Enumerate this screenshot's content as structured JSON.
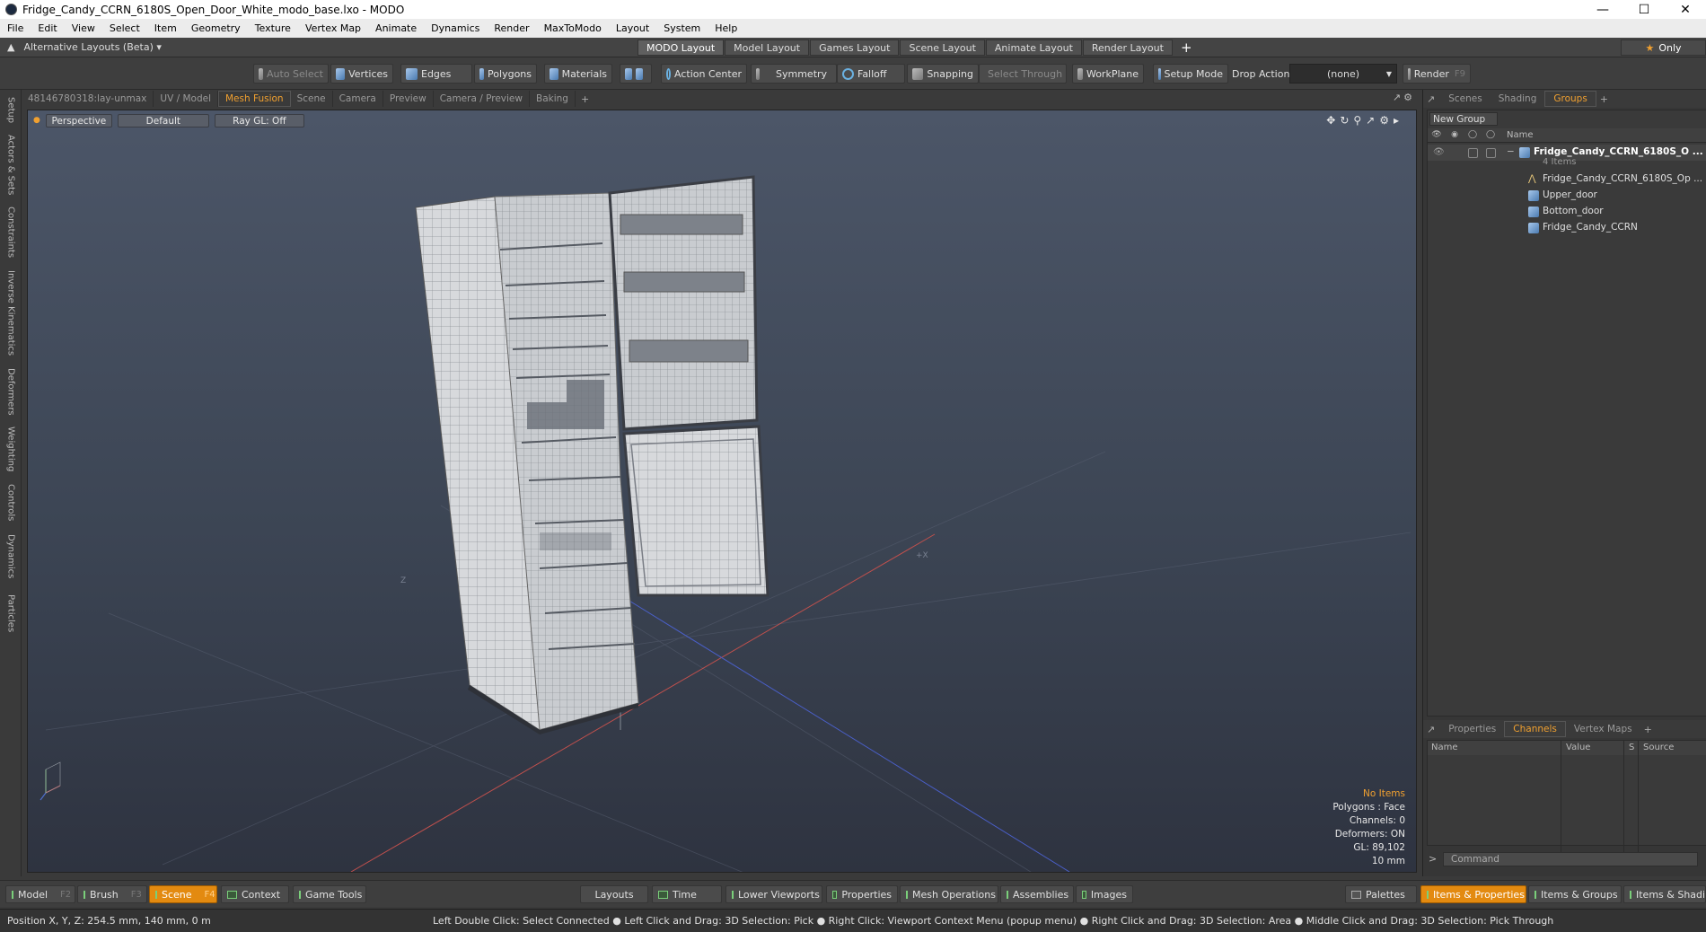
{
  "window": {
    "title": "Fridge_Candy_CCRN_6180S_Open_Door_White_modo_base.lxo - MODO"
  },
  "menu": [
    "File",
    "Edit",
    "View",
    "Select",
    "Item",
    "Geometry",
    "Texture",
    "Vertex Map",
    "Animate",
    "Dynamics",
    "Render",
    "MaxToModo",
    "Layout",
    "System",
    "Help"
  ],
  "layoutbar": {
    "alt_layouts": "Alternative Layouts (Beta) ▾",
    "tabs": [
      "MODO Layout",
      "Model Layout",
      "Games Layout",
      "Scene Layout",
      "Animate Layout",
      "Render Layout"
    ],
    "only": "Only"
  },
  "toolbar": {
    "auto_select": "Auto Select",
    "vertices": "Vertices",
    "edges": "Edges",
    "polygons": "Polygons",
    "materials": "Materials",
    "action_center": "Action Center",
    "symmetry": "Symmetry",
    "falloff": "Falloff",
    "snapping": "Snapping",
    "select_through": "Select Through",
    "workplane": "WorkPlane",
    "setup_mode": "Setup Mode",
    "drop_action": "Drop Action",
    "drop_value": "(none)",
    "render": "Render",
    "render_key": "F9"
  },
  "left_tabs": [
    "Setup",
    "Actors & Sets",
    "Constraints",
    "Inverse Kinematics",
    "Deformers",
    "Weighting",
    "Controls",
    "Dynamics",
    "Particles"
  ],
  "viewport_tabs": [
    "48146780318:lay-unmax",
    "UV / Model",
    "Mesh Fusion",
    "Scene",
    "Camera",
    "Preview",
    "Camera / Preview",
    "Baking"
  ],
  "viewport": {
    "view": "Perspective",
    "shading": "Default",
    "raygl": "Ray GL: Off",
    "info": {
      "selection": "No Items",
      "polygons": "Polygons : Face",
      "channels": "Channels: 0",
      "deformers": "Deformers: ON",
      "gl": "GL: 89,102",
      "scale": "10 mm"
    }
  },
  "right_tabs_top": [
    "Scenes",
    "Shading",
    "Groups"
  ],
  "groups": {
    "new_group": "New Group",
    "name_header": "Name",
    "root": {
      "label": "Fridge_Candy_CCRN_6180S_O ...",
      "count": "4 Items"
    },
    "children": [
      "Fridge_Candy_CCRN_6180S_Op ...",
      "Upper_door",
      "Bottom_door",
      "Fridge_Candy_CCRN"
    ]
  },
  "right_tabs_bottom": [
    "Properties",
    "Channels",
    "Vertex Maps"
  ],
  "channels": {
    "name": "Name",
    "value": "Value",
    "s": "S",
    "source": "Source"
  },
  "command": {
    "placeholder": "Command"
  },
  "bottom": {
    "model": "Model",
    "model_key": "F2",
    "brush": "Brush",
    "brush_key": "F3",
    "scene": "Scene",
    "scene_key": "F4",
    "context": "Context",
    "game_tools": "Game Tools",
    "layouts": "Layouts",
    "time": "Time",
    "lower_viewports": "Lower Viewports",
    "properties": "Properties",
    "mesh_operations": "Mesh Operations",
    "assemblies": "Assemblies",
    "images": "Images",
    "palettes": "Palettes",
    "items_properties": "Items & Properties",
    "items_groups": "Items & Groups",
    "items_shading": "Items & Shadin"
  },
  "status": {
    "position": "Position X, Y, Z:   254.5 mm, 140 mm, 0 m",
    "hint": "Left Double Click: Select Connected ● Left Click and Drag: 3D Selection: Pick ● Right Click: Viewport Context Menu (popup menu) ● Right Click and Drag: 3D Selection: Area ● Middle Click and Drag: 3D Selection: Pick Through"
  }
}
